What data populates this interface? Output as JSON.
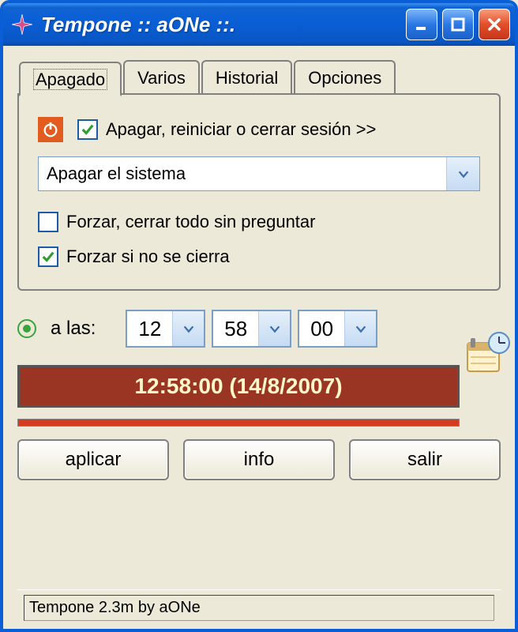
{
  "window": {
    "title": "Tempone :: aONe ::."
  },
  "tabs": {
    "items": [
      {
        "label": "Apagado"
      },
      {
        "label": "Varios"
      },
      {
        "label": "Historial"
      },
      {
        "label": "Opciones"
      }
    ]
  },
  "panel": {
    "apagar_checkbox_label": "Apagar, reiniciar o cerrar sesión >>",
    "combo_value": "Apagar el sistema",
    "forzar_todo_label": "Forzar, cerrar todo sin preguntar",
    "forzar_no_cierra_label": "Forzar si no se cierra"
  },
  "time": {
    "radio_label": "a las:",
    "hour": "12",
    "minute": "58",
    "second": "00"
  },
  "display": {
    "text": "12:58:00 (14/8/2007)"
  },
  "buttons": {
    "apply": "aplicar",
    "info": "info",
    "exit": "salir"
  },
  "statusbar": "Tempone 2.3m by aONe"
}
